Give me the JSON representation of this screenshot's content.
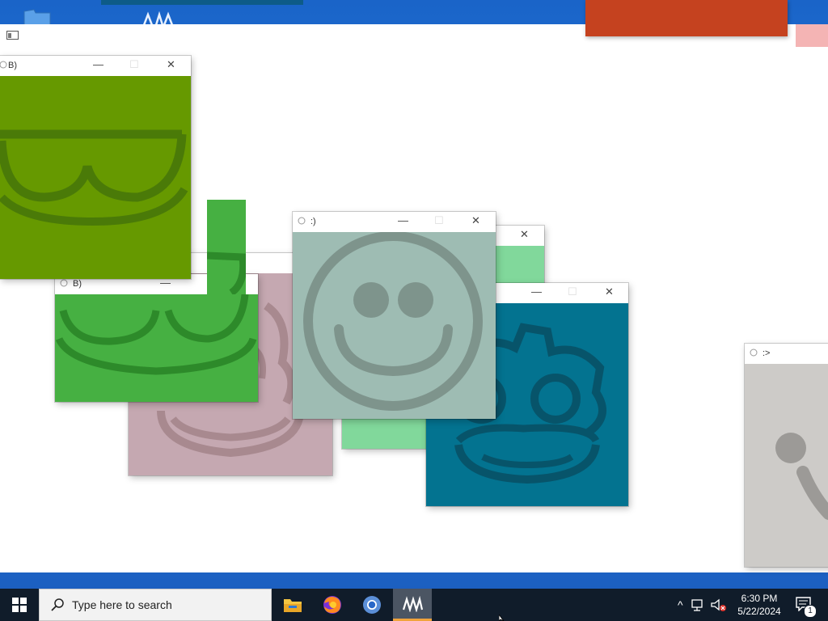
{
  "windows": [
    {
      "id": "sunglasses",
      "title": "B)",
      "minimize": "—",
      "maximize": "☐",
      "close": "✕"
    },
    {
      "id": "green",
      "title": "B)",
      "minimize": "—"
    },
    {
      "id": "smile",
      "title": ":)",
      "minimize": "—",
      "maximize": "☐",
      "close": "✕"
    },
    {
      "id": "teal",
      "minimize": "—",
      "maximize": "☐",
      "close": "✕"
    },
    {
      "id": "mint",
      "close": "✕"
    },
    {
      "id": "gray",
      "title": ":>"
    }
  ],
  "taskbar": {
    "search_placeholder": "Type here to search",
    "apps": [
      "file-explorer",
      "firefox",
      "chromium",
      "godot-app"
    ],
    "clock_time": "6:30 PM",
    "clock_date": "5/22/2024",
    "notification_count": "1"
  },
  "colors": {
    "sunglasses_bg": "#669900",
    "sunglasses_ink": "#4a7a08",
    "green_bg": "#46b042",
    "green_ink": "#2d8a2a",
    "pink_bg": "#c5a8b1",
    "pink_ink": "#a8898f",
    "smile_bg": "#9ebcb3",
    "smile_ink": "#7e948c",
    "teal_bg": "#037390",
    "teal_ink": "#07546a",
    "mint_bg": "#81d89b",
    "gray_bg": "#cdcbc8",
    "gray_ink": "#9c9a97",
    "red_block": "#c5421f"
  }
}
